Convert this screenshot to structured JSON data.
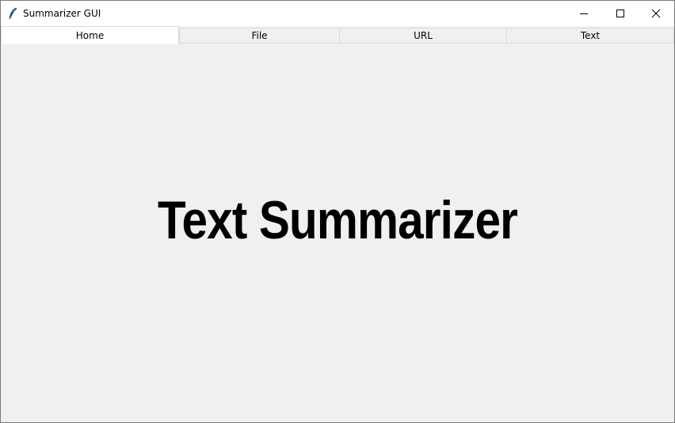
{
  "window": {
    "title": "Summarizer GUI",
    "app_icon": "feather-icon"
  },
  "controls": {
    "minimize_icon": "minimize-icon",
    "maximize_icon": "maximize-icon",
    "close_icon": "close-icon"
  },
  "tabs": [
    {
      "label": "Home",
      "selected": true
    },
    {
      "label": "File",
      "selected": false
    },
    {
      "label": "URL",
      "selected": false
    },
    {
      "label": "Text",
      "selected": false
    }
  ],
  "home": {
    "heading": "Text Summarizer"
  },
  "colors": {
    "background": "#f0f0f0",
    "titlebar": "#ffffff",
    "tab_border": "#d9d9d9",
    "heading": "#000000"
  }
}
